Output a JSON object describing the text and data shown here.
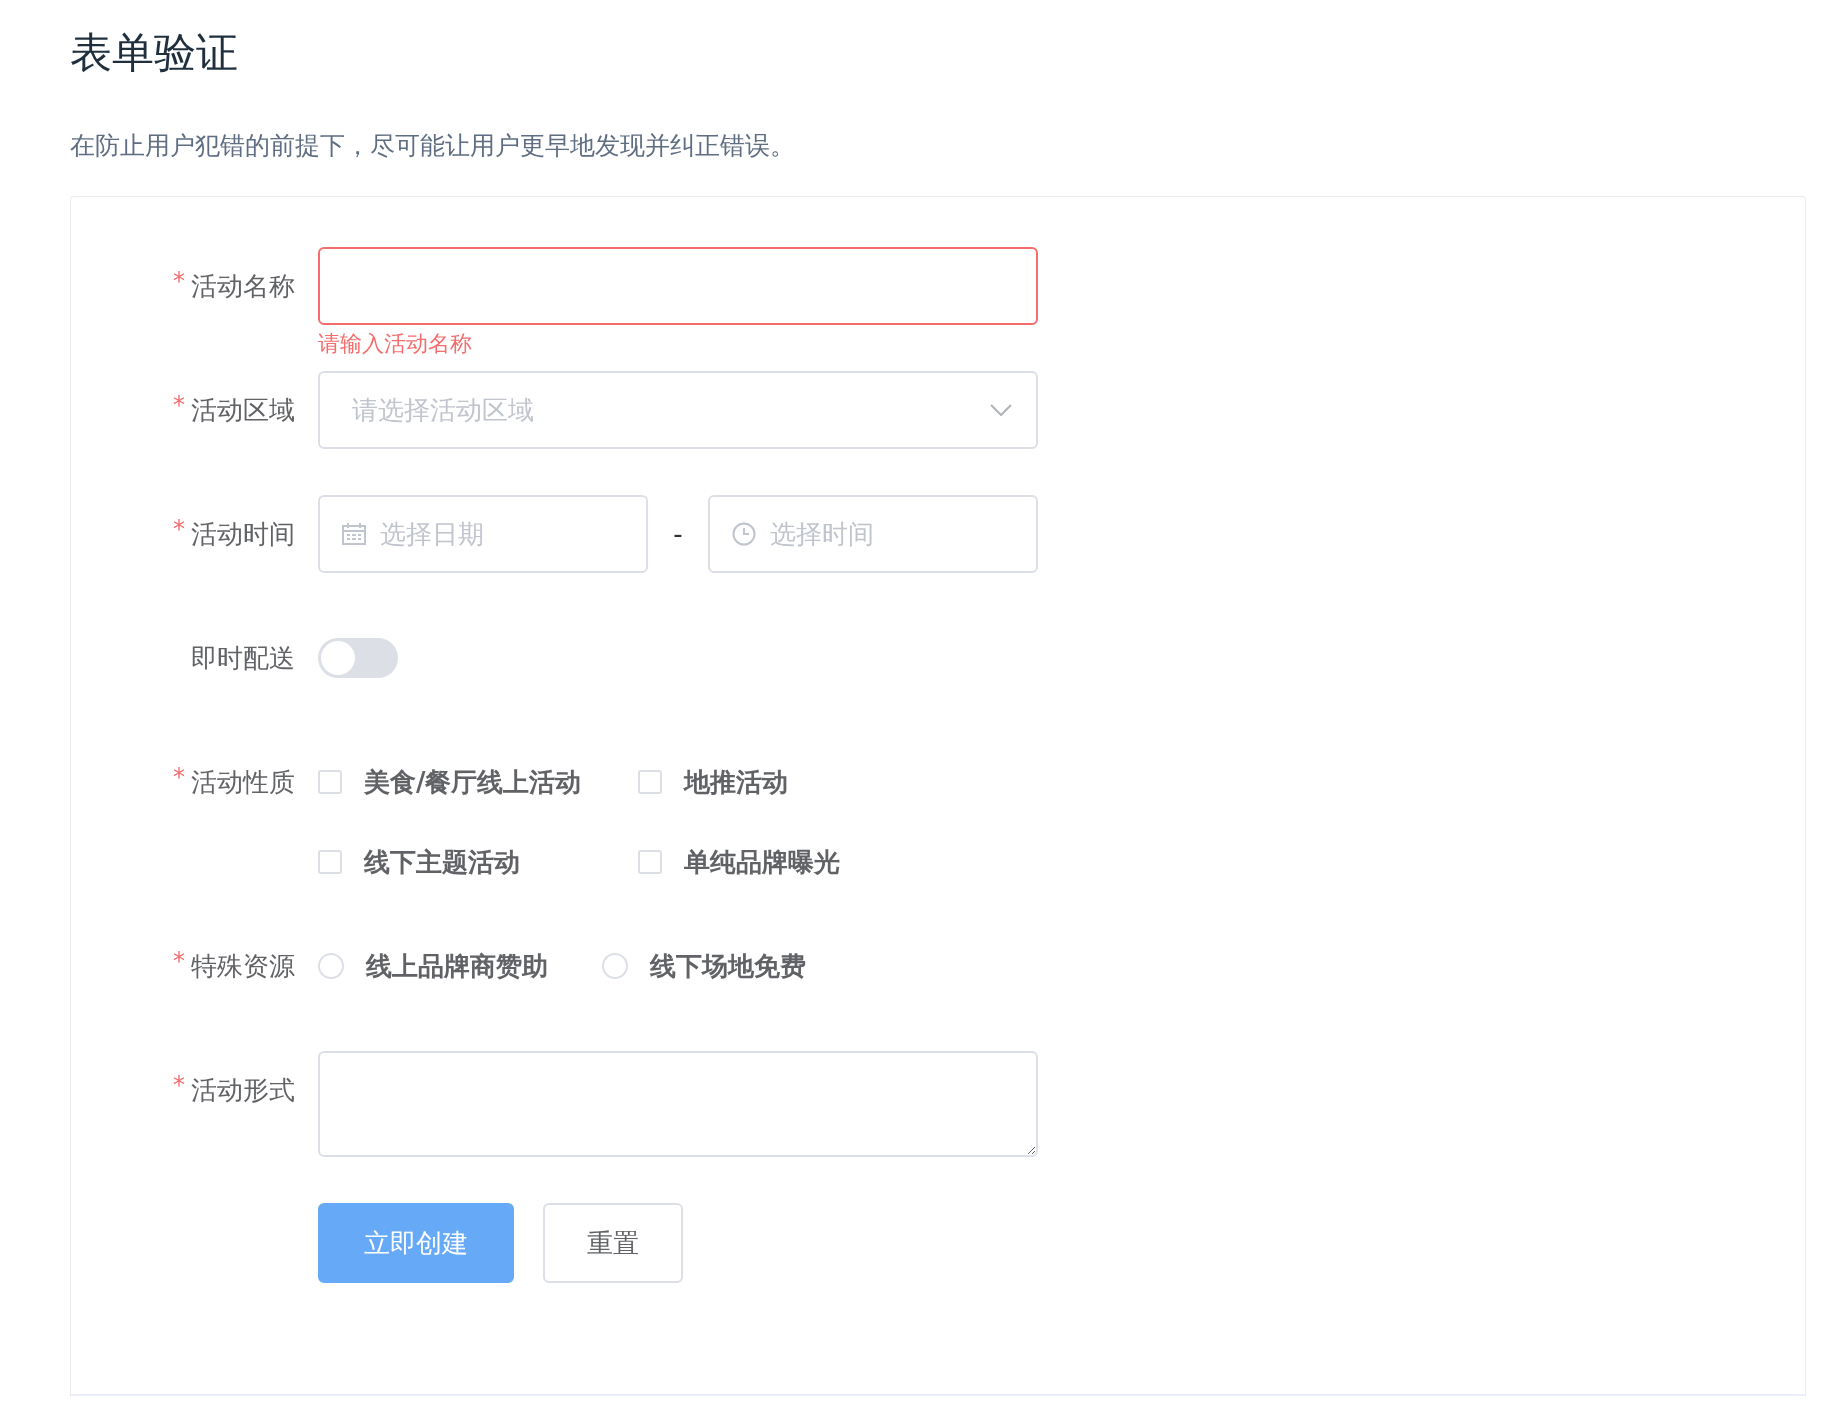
{
  "title": "表单验证",
  "description": "在防止用户犯错的前提下，尽可能让用户更早地发现并纠正错误。",
  "form": {
    "required_mark": "*",
    "items": [
      {
        "kind": "input",
        "label": "活动名称",
        "required": true,
        "error": "请输入活动名称"
      },
      {
        "kind": "select",
        "label": "活动区域",
        "required": true,
        "placeholder": "请选择活动区域"
      },
      {
        "kind": "datetime",
        "label": "活动时间",
        "required": true,
        "date_placeholder": "选择日期",
        "separator": "-",
        "time_placeholder": "选择时间"
      },
      {
        "kind": "switch",
        "label": "即时配送",
        "required": false,
        "on": false
      },
      {
        "kind": "checkbox",
        "label": "活动性质",
        "required": true,
        "options": [
          {
            "label": "美食/餐厅线上活动",
            "checked": false
          },
          {
            "label": "地推活动",
            "checked": false
          },
          {
            "label": "线下主题活动",
            "checked": false
          },
          {
            "label": "单纯品牌曝光",
            "checked": false
          }
        ]
      },
      {
        "kind": "radio",
        "label": "特殊资源",
        "required": true,
        "options": [
          {
            "label": "线上品牌商赞助",
            "selected": false
          },
          {
            "label": "线下场地免费",
            "selected": false
          }
        ]
      },
      {
        "kind": "textarea",
        "label": "活动形式",
        "required": true
      }
    ],
    "buttons": [
      {
        "label": "立即创建",
        "kind": "primary"
      },
      {
        "label": "重置",
        "kind": "default"
      }
    ]
  }
}
